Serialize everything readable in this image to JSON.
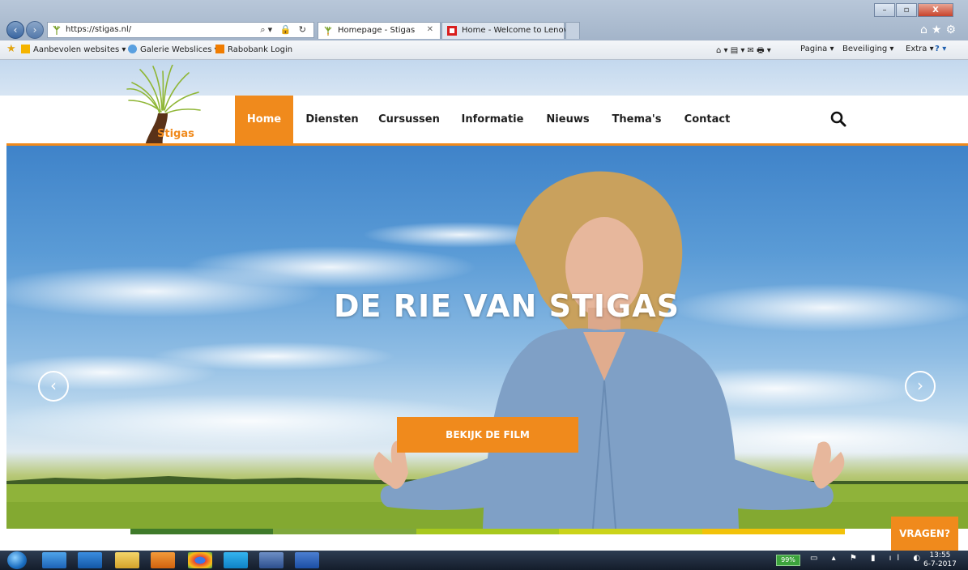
{
  "browser": {
    "url": "https://stigas.nl/",
    "tabs": [
      {
        "label": "Homepage - Stigas",
        "active": true
      },
      {
        "label": "Home - Welcome to Lenovo",
        "active": false
      }
    ],
    "favorites": [
      "Aanbevolen websites ▾",
      "Galerie Webslices ▾",
      "Rabobank Login"
    ],
    "commands": [
      "Pagina ▾",
      "Beveiliging ▾",
      "Extra ▾"
    ]
  },
  "site": {
    "logo_text": "Stigas",
    "nav": [
      "Home",
      "Diensten",
      "Cursussen",
      "Informatie",
      "Nieuws",
      "Thema's",
      "Contact"
    ],
    "active_nav": "Home",
    "hero": {
      "title": "DE RIE VAN STIGAS",
      "button": "BEKIJK DE FILM",
      "slide_count": 3,
      "active_slide": 2
    },
    "vragen_button": "VRAGEN?",
    "colors": {
      "accent": "#f08a1c",
      "colorbar": [
        "#3f7a2a",
        "#7fa83c",
        "#a8c81e",
        "#cbd31a",
        "#f2c20a",
        "#ffffff"
      ]
    }
  },
  "taskbar": {
    "battery": "99%",
    "time": "13:55",
    "date": "6-7-2017",
    "apps": [
      "ie-icon",
      "outlook-icon",
      "explorer-icon",
      "media-icon",
      "chrome-icon",
      "skype-icon",
      "app-icon",
      "word-icon"
    ]
  }
}
